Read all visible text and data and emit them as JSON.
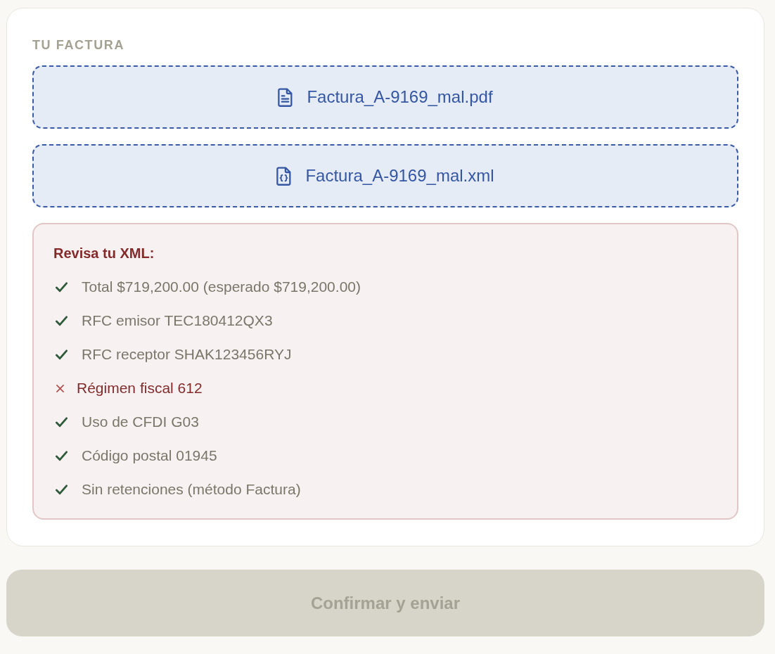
{
  "section_label": "TU FACTURA",
  "files": [
    {
      "kind": "pdf",
      "name": "Factura_A-9169_mal.pdf"
    },
    {
      "kind": "xml",
      "name": "Factura_A-9169_mal.xml"
    }
  ],
  "validation": {
    "title": "Revisa tu XML:",
    "checks": [
      {
        "text": "Total $719,200.00 (esperado $719,200.00)",
        "passed": true
      },
      {
        "text": "RFC emisor TEC180412QX3",
        "passed": true
      },
      {
        "text": "RFC receptor SHAK123456RYJ",
        "passed": true
      },
      {
        "text": "Régimen fiscal 612",
        "passed": false
      },
      {
        "text": "Uso de CFDI G03",
        "passed": true
      },
      {
        "text": "Código postal 01945",
        "passed": true
      },
      {
        "text": "Sin retenciones (método Factura)",
        "passed": true
      }
    ]
  },
  "submit_button": {
    "label": "Confirmar y enviar",
    "disabled": true
  }
}
